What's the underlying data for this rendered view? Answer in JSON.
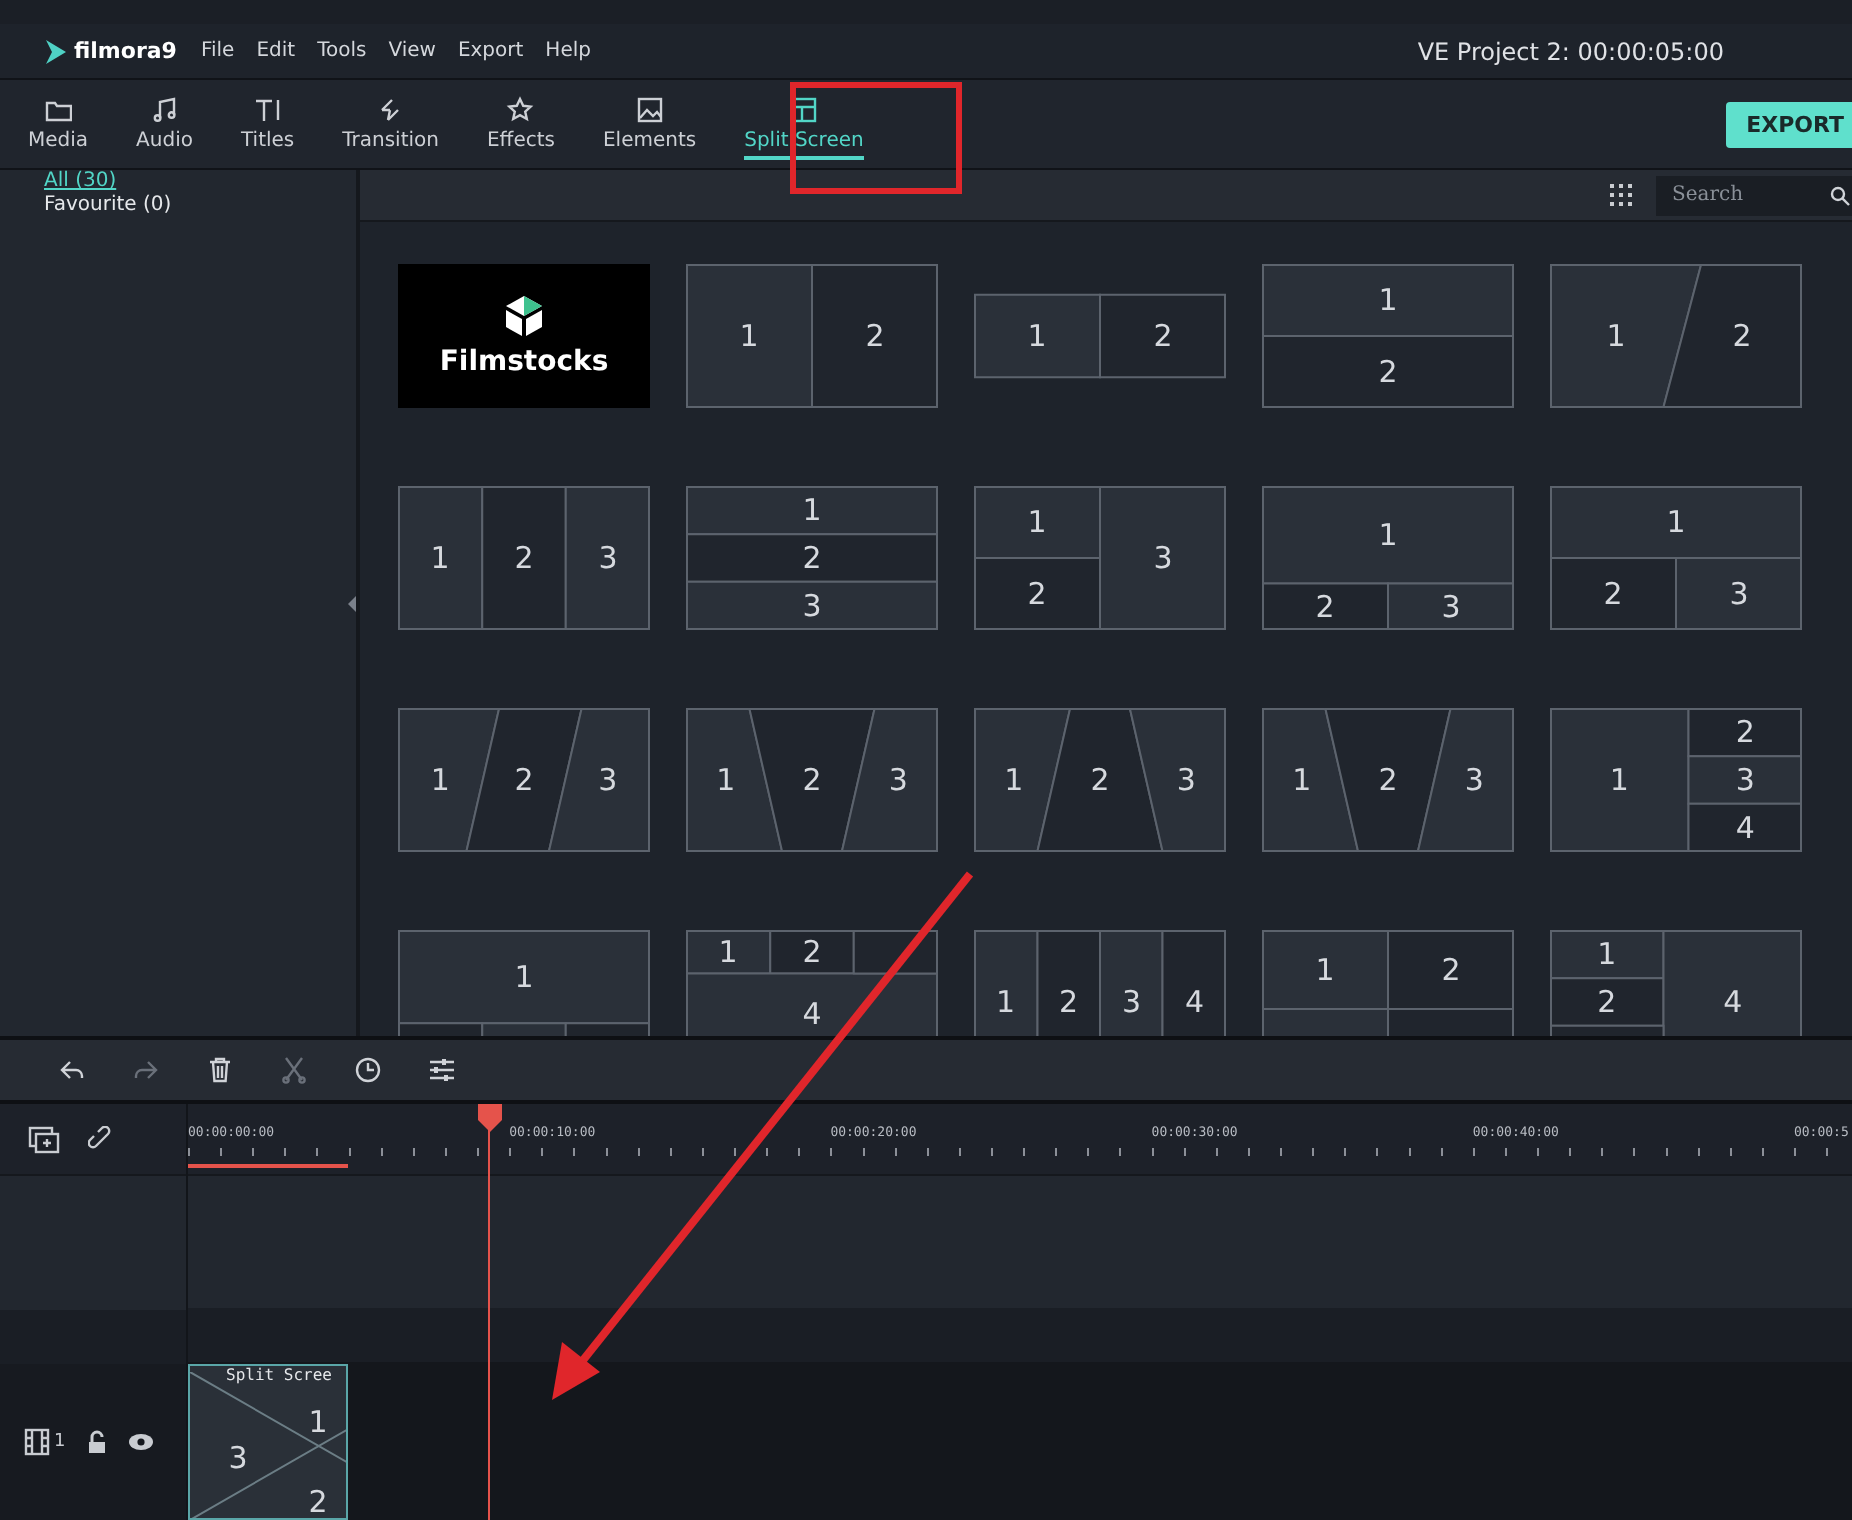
{
  "app": {
    "logo": "filmora9",
    "menu": [
      "File",
      "Edit",
      "Tools",
      "View",
      "Export",
      "Help"
    ],
    "project": "VE Project 2: 00:00:05:00"
  },
  "tabs": [
    {
      "kind": "media",
      "label": "Media",
      "selected": false
    },
    {
      "kind": "audio",
      "label": "Audio",
      "selected": false
    },
    {
      "kind": "titles",
      "label": "Titles",
      "selected": false
    },
    {
      "kind": "transition",
      "label": "Transition",
      "selected": false
    },
    {
      "kind": "effects",
      "label": "Effects",
      "selected": false
    },
    {
      "kind": "elements",
      "label": "Elements",
      "selected": false
    },
    {
      "kind": "split",
      "label": "Split Screen",
      "selected": true
    }
  ],
  "export_button": "EXPORT",
  "sidebar": {
    "items": [
      {
        "label": "All (30)",
        "selected": true
      },
      {
        "label": "Favourite (0)",
        "selected": false
      }
    ]
  },
  "search": {
    "placeholder": "Search"
  },
  "split_screens": [
    {
      "kind": "filmstocks",
      "label": "Filmstocks"
    },
    {
      "kind": "h2",
      "cells": [
        "1",
        "2"
      ]
    },
    {
      "kind": "h2short",
      "cells": [
        "1",
        "2"
      ]
    },
    {
      "kind": "v2",
      "cells": [
        "1",
        "2"
      ]
    },
    {
      "kind": "slant2",
      "cells": [
        "1",
        "2"
      ]
    },
    {
      "kind": "h3",
      "cells": [
        "1",
        "2",
        "3"
      ]
    },
    {
      "kind": "v3",
      "cells": [
        "1",
        "2",
        "3"
      ]
    },
    {
      "kind": "l2r1",
      "cells": [
        "1",
        "2",
        "3"
      ]
    },
    {
      "kind": "t1b2",
      "cells": [
        "1",
        "2",
        "3"
      ]
    },
    {
      "kind": "t1b2e",
      "cells": [
        "1",
        "2",
        "3"
      ]
    },
    {
      "kind": "slant3",
      "cells": [
        "1",
        "2",
        "3"
      ]
    },
    {
      "kind": "trap3",
      "cells": [
        "1",
        "2",
        "3"
      ]
    },
    {
      "kind": "trap3inv",
      "cells": [
        "1",
        "2",
        "3"
      ]
    },
    {
      "kind": "trap3",
      "cells": [
        "1",
        "2",
        "3"
      ]
    },
    {
      "kind": "r3col",
      "cells": [
        "1",
        "2",
        "3",
        "4"
      ]
    },
    {
      "kind": "t1b3",
      "cells": [
        "1"
      ]
    },
    {
      "kind": "t3b1",
      "cells": [
        "1",
        "2",
        "4"
      ]
    },
    {
      "kind": "h4",
      "cells": [
        "1",
        "2",
        "3",
        "4"
      ]
    },
    {
      "kind": "g2x2",
      "cells": [
        "1",
        "2"
      ]
    },
    {
      "kind": "l3r1",
      "cells": [
        "1",
        "2",
        "4"
      ]
    }
  ],
  "toolbar": [
    {
      "kind": "undo",
      "disabled": false
    },
    {
      "kind": "redo",
      "disabled": true
    },
    {
      "kind": "delete",
      "disabled": false
    },
    {
      "kind": "cut",
      "disabled": true
    },
    {
      "kind": "speed",
      "disabled": false
    },
    {
      "kind": "adjust",
      "disabled": false
    }
  ],
  "timeline": {
    "ruler": [
      "00:00:00:00",
      "00:00:10:00",
      "00:00:20:00",
      "00:00:30:00",
      "00:00:40:00",
      "00:00:5"
    ],
    "track_number": "1",
    "clip": {
      "title": "Split Scree",
      "cells": [
        "3",
        "1",
        "2"
      ]
    }
  }
}
